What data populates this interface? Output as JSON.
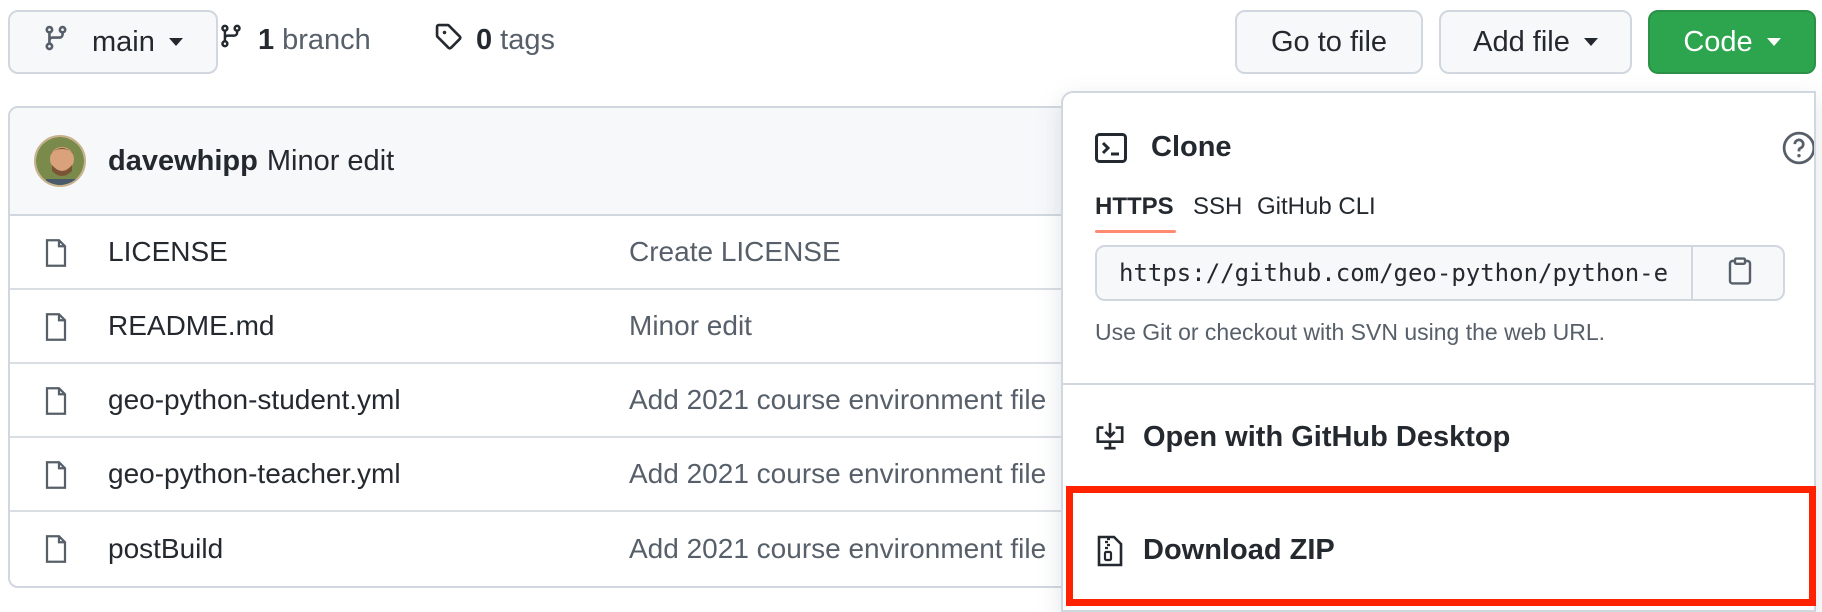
{
  "toolbar": {
    "branch_label": "main",
    "branch_count": "1",
    "branch_word": "branch",
    "tag_count": "0",
    "tag_word": "tags",
    "goto_file_label": "Go to file",
    "add_file_label": "Add file",
    "code_label": "Code"
  },
  "latest_commit": {
    "author": "davewhipp",
    "message": "Minor edit"
  },
  "files": [
    {
      "name": "LICENSE",
      "message": "Create LICENSE"
    },
    {
      "name": "README.md",
      "message": "Minor edit"
    },
    {
      "name": "geo-python-student.yml",
      "message": "Add 2021 course environment file"
    },
    {
      "name": "geo-python-teacher.yml",
      "message": "Add 2021 course environment file"
    },
    {
      "name": "postBuild",
      "message": "Add 2021 course environment file"
    }
  ],
  "dropdown": {
    "clone_title": "Clone",
    "tabs": [
      "HTTPS",
      "SSH",
      "GitHub CLI"
    ],
    "url": "https://github.com/geo-python/python-e",
    "hint": "Use Git or checkout with SVN using the web URL.",
    "open_desktop": "Open with GitHub Desktop",
    "download_zip": "Download ZIP"
  },
  "colors": {
    "code_button": "#2da44e",
    "highlight": "#ff2200",
    "tab_underline": "#fd8c73"
  }
}
